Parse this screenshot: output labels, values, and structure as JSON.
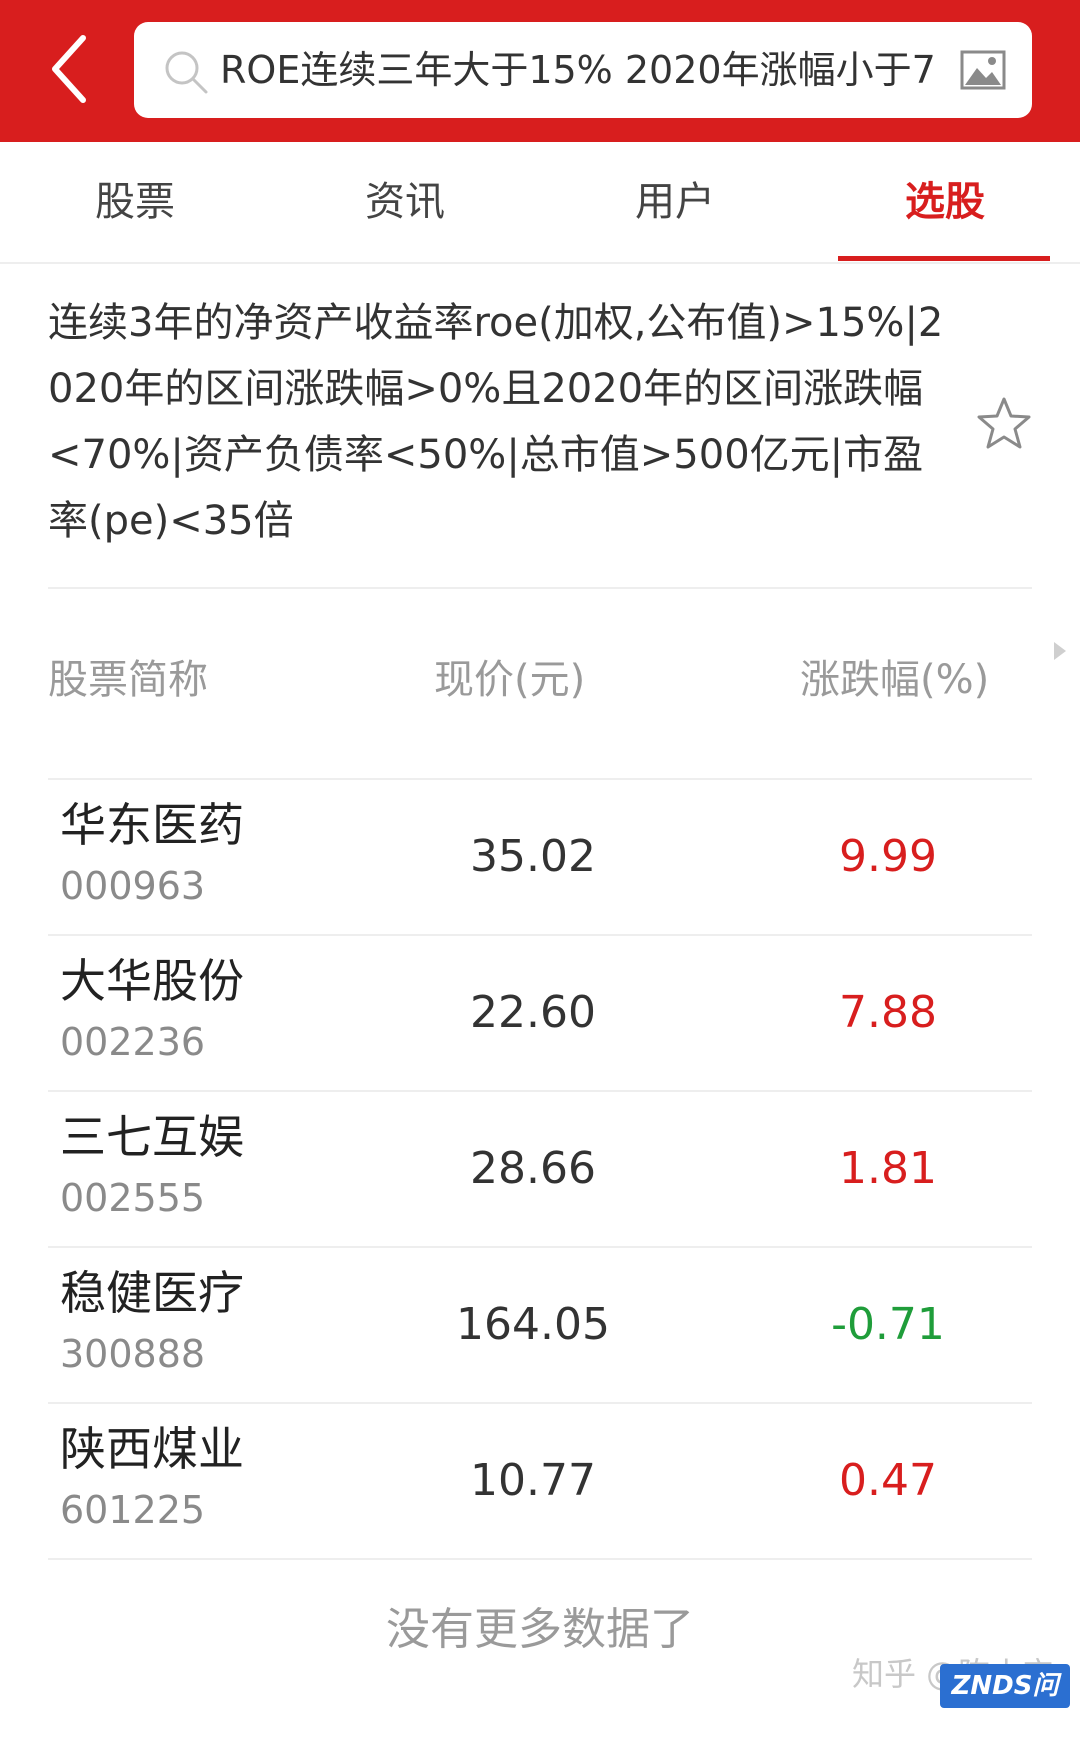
{
  "search": {
    "query": "ROE连续三年大于15% 2020年涨幅小于7"
  },
  "icons": {
    "back": "chevron-left-icon",
    "search": "search-icon",
    "image": "image-icon",
    "favorite": "star-outline-icon",
    "scroll_right": "triangle-right-icon"
  },
  "tabs": [
    {
      "label": "股票",
      "active": false
    },
    {
      "label": "资讯",
      "active": false
    },
    {
      "label": "用户",
      "active": false
    },
    {
      "label": "选股",
      "active": true
    }
  ],
  "condition_text": "连续3年的净资产收益率roe(加权,公布值)>15%|2020年的区间涨跌幅>0%且2020年的区间涨跌幅<70%|资产负债率<50%|总市值>500亿元|市盈率(pe)<35倍",
  "table": {
    "headers": {
      "name": "股票简称",
      "price": "现价(元)",
      "change": "涨跌幅(%)"
    },
    "rows": [
      {
        "name": "华东医药",
        "code": "000963",
        "price": "35.02",
        "change": "9.99",
        "direction": "up"
      },
      {
        "name": "大华股份",
        "code": "002236",
        "price": "22.60",
        "change": "7.88",
        "direction": "up"
      },
      {
        "name": "三七互娱",
        "code": "002555",
        "price": "28.66",
        "change": "1.81",
        "direction": "up"
      },
      {
        "name": "稳健医疗",
        "code": "300888",
        "price": "164.05",
        "change": "-0.71",
        "direction": "down"
      },
      {
        "name": "陕西煤业",
        "code": "601225",
        "price": "10.77",
        "change": "0.47",
        "direction": "up"
      }
    ]
  },
  "footer": {
    "no_more": "没有更多数据了"
  },
  "watermarks": {
    "zhihu": "知乎 @陈小宝",
    "znds": "ZNDS问答"
  },
  "colors": {
    "brand_red": "#d81e1e",
    "up": "#d81e1e",
    "down": "#1f9d3a"
  }
}
